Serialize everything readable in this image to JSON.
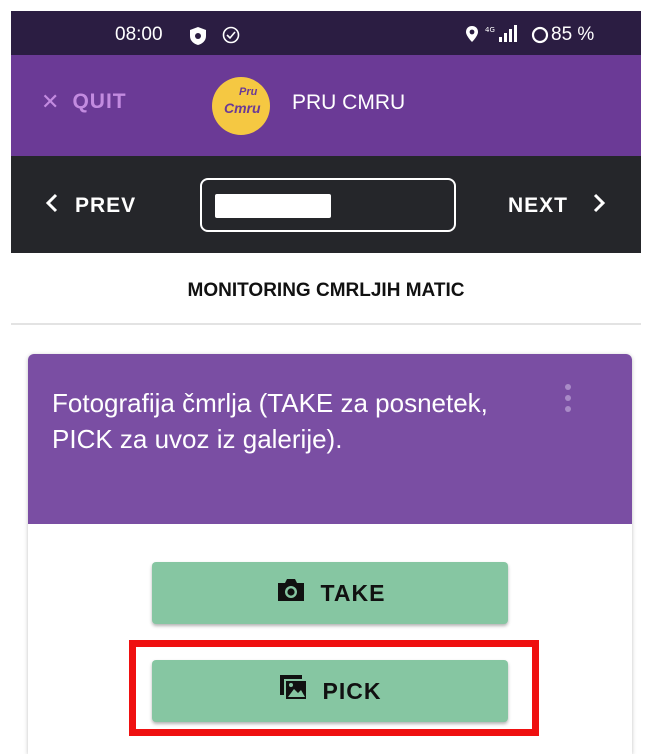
{
  "status_bar": {
    "time": "08:00",
    "battery": "85 %",
    "icons": [
      "shield-icon",
      "check-circle-icon",
      "location-icon",
      "signal-4g-icon",
      "battery-ring-icon"
    ]
  },
  "app_bar": {
    "quit_label": "QUIT",
    "logo_line1": "Pru",
    "logo_line2": "Cmru",
    "title": "PRU CMRU",
    "colors": {
      "app_bar": "#6b3a96",
      "quit": "#c38be0",
      "logo": "#f5c842"
    }
  },
  "nav": {
    "prev_label": "PREV",
    "next_label": "NEXT"
  },
  "section": {
    "title": "MONITORING CMRLJIH MATIC"
  },
  "question": {
    "text": "Fotografija čmrlja (TAKE za posnetek, PICK za uvoz iz galerije).",
    "header_color": "#7a4ea3"
  },
  "buttons": {
    "take_label": "TAKE",
    "pick_label": "PICK",
    "color": "#86c6a2"
  },
  "highlight_color": "#ef1010"
}
